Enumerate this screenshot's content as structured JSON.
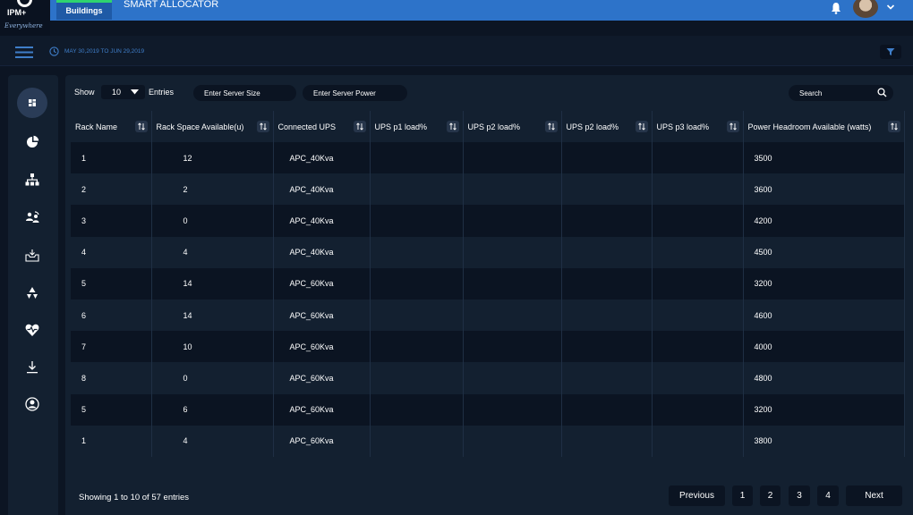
{
  "header": {
    "logo_text": "IPM+",
    "logo_subtext": "Everywhere",
    "module_tab": "Buildings",
    "app_title": "SMART ALLOCATOR",
    "icons": [
      "bell-icon",
      "avatar",
      "chevron-down-icon"
    ]
  },
  "subbar": {
    "date_range": "MAY 30,2019 TO JUN 29,2019",
    "icons": [
      "menu-icon",
      "clock-icon",
      "filter-icon"
    ]
  },
  "sidebar": {
    "items": [
      {
        "icon": "dashboard-icon",
        "active": true
      },
      {
        "icon": "pie-chart-icon",
        "active": false
      },
      {
        "icon": "hierarchy-icon",
        "active": false
      },
      {
        "icon": "user-sync-icon",
        "active": false
      },
      {
        "icon": "inbox-icon",
        "active": false
      },
      {
        "icon": "recycle-icon",
        "active": false
      },
      {
        "icon": "heartbeat-icon",
        "active": false
      },
      {
        "icon": "download-icon",
        "active": false
      },
      {
        "icon": "user-circle-icon",
        "active": false
      }
    ]
  },
  "toolbar": {
    "show_label": "Show",
    "entries_value": "10",
    "entries_label": "Entries",
    "server_size_placeholder": "Enter Server Size",
    "server_power_placeholder": "Enter Server Power",
    "search_placeholder": "Search"
  },
  "table": {
    "columns": [
      "Rack Name",
      "Rack Space Available(u)",
      "Connected UPS",
      "UPS p1 load%",
      "UPS p2 load%",
      "UPS p2 load%",
      "UPS p3 load%",
      "Power Headroom Available (watts)"
    ],
    "rows": [
      [
        "1",
        "12",
        "APC_40Kva",
        "",
        "",
        "",
        "",
        "3500"
      ],
      [
        "2",
        "2",
        "APC_40Kva",
        "",
        "",
        "",
        "",
        "3600"
      ],
      [
        "3",
        "0",
        "APC_40Kva",
        "",
        "",
        "",
        "",
        "4200"
      ],
      [
        "4",
        "4",
        "APC_40Kva",
        "",
        "",
        "",
        "",
        "4500"
      ],
      [
        "5",
        "14",
        "APC_60Kva",
        "",
        "",
        "",
        "",
        "3200"
      ],
      [
        "6",
        "14",
        "APC_60Kva",
        "",
        "",
        "",
        "",
        "4600"
      ],
      [
        "7",
        "10",
        "APC_60Kva",
        "",
        "",
        "",
        "",
        "4000"
      ],
      [
        "8",
        "0",
        "APC_60Kva",
        "",
        "",
        "",
        "",
        "4800"
      ],
      [
        "5",
        "6",
        "APC_60Kva",
        "",
        "",
        "",
        "",
        "3200"
      ],
      [
        "1",
        "4",
        "APC_60Kva",
        "",
        "",
        "",
        "",
        "3800"
      ]
    ]
  },
  "footer": {
    "summary": "Showing 1 to 10 of 57 entries",
    "previous_label": "Previous",
    "pages": [
      "1",
      "2",
      "3",
      "4"
    ],
    "next_label": "Next"
  },
  "colors": {
    "topbar": "#2d73c9",
    "background": "#0c1523",
    "panel": "#132030",
    "row_alt": "#0b1422",
    "accent_green": "#2fd36f",
    "date_text": "#3f7ec9"
  }
}
